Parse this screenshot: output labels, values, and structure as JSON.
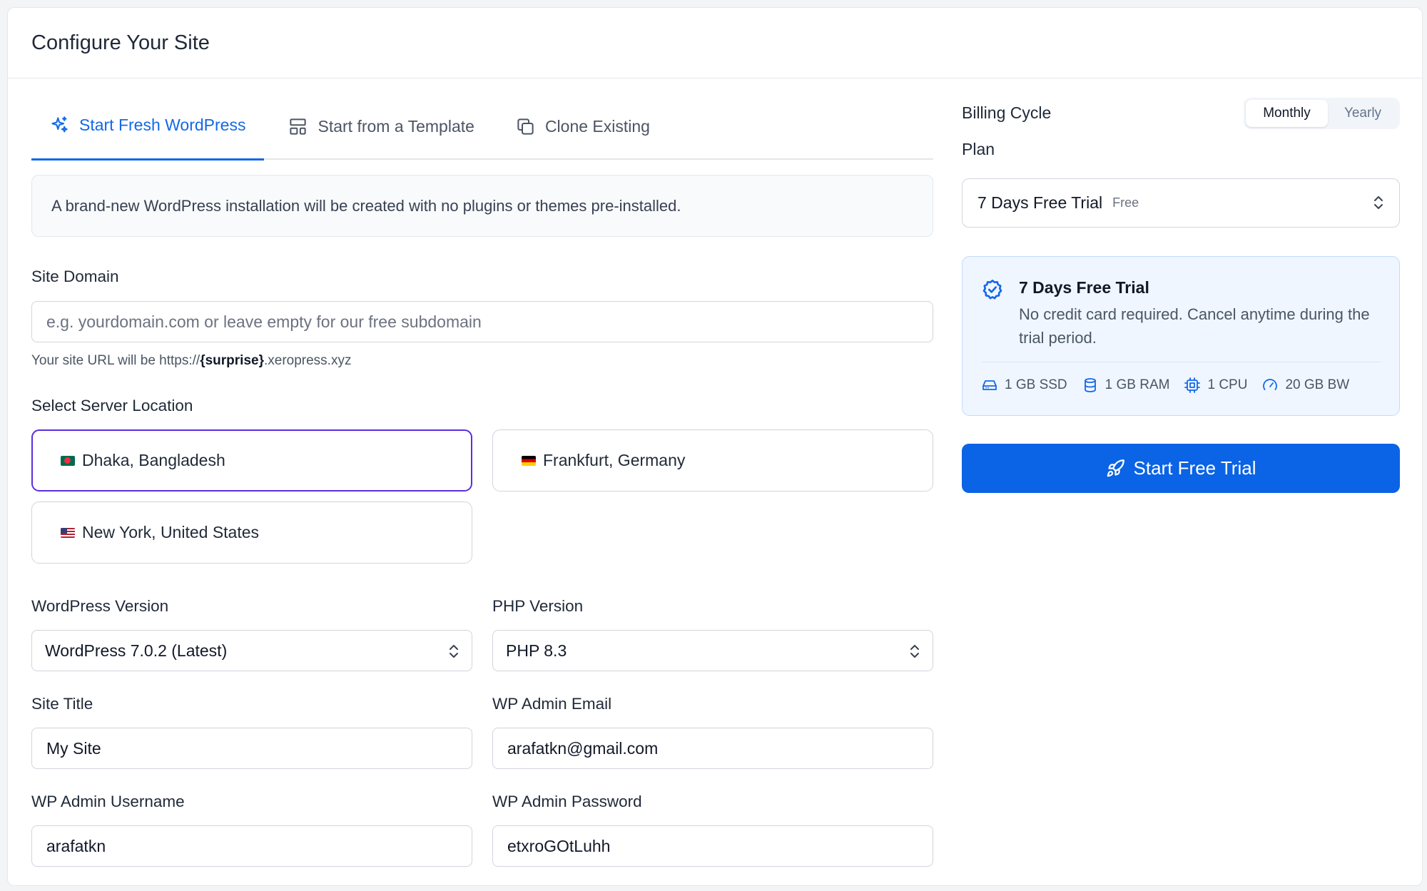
{
  "header": {
    "title": "Configure Your Site"
  },
  "tabs": [
    {
      "label": "Start Fresh WordPress",
      "icon": "sparkles-icon",
      "active": true
    },
    {
      "label": "Start from a Template",
      "icon": "template-icon",
      "active": false
    },
    {
      "label": "Clone Existing",
      "icon": "copy-icon",
      "active": false
    }
  ],
  "info": {
    "text": "A brand-new WordPress installation will be created with no plugins or themes pre-installed."
  },
  "domain": {
    "label": "Site Domain",
    "placeholder": "e.g. yourdomain.com or leave empty for our free subdomain",
    "value": "",
    "hint_prefix": "Your site URL will be https://",
    "hint_bold": "{surprise}",
    "hint_suffix": ".xeropress.xyz"
  },
  "locations": {
    "label": "Select Server Location",
    "items": [
      {
        "name": "Dhaka, Bangladesh",
        "flag": "bd",
        "selected": true
      },
      {
        "name": "Frankfurt, Germany",
        "flag": "de",
        "selected": false
      },
      {
        "name": "New York, United States",
        "flag": "us",
        "selected": false
      }
    ]
  },
  "wp_version": {
    "label": "WordPress Version",
    "value": "WordPress 7.0.2 (Latest)"
  },
  "php_version": {
    "label": "PHP Version",
    "value": "PHP 8.3"
  },
  "site_title": {
    "label": "Site Title",
    "value": "My Site"
  },
  "admin_email": {
    "label": "WP Admin Email",
    "value": "arafatkn@gmail.com"
  },
  "admin_username": {
    "label": "WP Admin Username",
    "value": "arafatkn"
  },
  "admin_password": {
    "label": "WP Admin Password",
    "value": "etxroGOtLuhh"
  },
  "billing": {
    "label": "Billing Cycle",
    "options": [
      "Monthly",
      "Yearly"
    ],
    "selected": "Monthly"
  },
  "plan": {
    "label": "Plan",
    "name": "7 Days Free Trial",
    "badge": "Free"
  },
  "trial": {
    "title": "7 Days Free Trial",
    "description": "No credit card required. Cancel anytime during the trial period.",
    "specs": [
      {
        "icon": "drive-icon",
        "text": "1 GB SSD"
      },
      {
        "icon": "database-icon",
        "text": "1 GB RAM"
      },
      {
        "icon": "cpu-icon",
        "text": "1 CPU"
      },
      {
        "icon": "gauge-icon",
        "text": "20 GB BW"
      }
    ]
  },
  "cta": {
    "label": "Start Free Trial"
  },
  "colors": {
    "accent": "#1368e8",
    "button": "#0b63e5",
    "selected_border": "#5b2fdc"
  }
}
